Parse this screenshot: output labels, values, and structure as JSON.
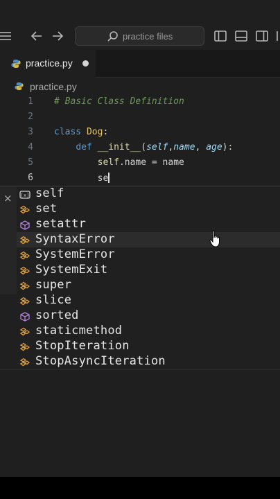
{
  "titlebar": {
    "search_label": "practice files"
  },
  "tabs": [
    {
      "label": "practice.py",
      "dirty": true
    }
  ],
  "breadcrumb": {
    "file": "practice.py"
  },
  "editor": {
    "lines": [
      {
        "number": "1",
        "text": "# Basic Class Definition"
      },
      {
        "number": "2",
        "text": ""
      },
      {
        "number": "3",
        "text": "class Dog:"
      },
      {
        "number": "4",
        "text": "    def __init__(self,name, age):"
      },
      {
        "number": "5",
        "text": "        self.name = name"
      },
      {
        "number": "6",
        "text": "        se"
      }
    ]
  },
  "suggest": {
    "close_label": "×",
    "items": [
      {
        "label": "self",
        "kind": "variable-icon"
      },
      {
        "label": "set",
        "kind": "class-icon"
      },
      {
        "label": "setattr",
        "kind": "method-icon"
      },
      {
        "label": "SyntaxError",
        "kind": "class-icon"
      },
      {
        "label": "SystemError",
        "kind": "class-icon"
      },
      {
        "label": "SystemExit",
        "kind": "class-icon"
      },
      {
        "label": "super",
        "kind": "class-icon"
      },
      {
        "label": "slice",
        "kind": "class-icon"
      },
      {
        "label": "sorted",
        "kind": "method-icon"
      },
      {
        "label": "staticmethod",
        "kind": "class-icon"
      },
      {
        "label": "StopIteration",
        "kind": "class-icon"
      },
      {
        "label": "StopAsyncIteration",
        "kind": "class-icon"
      }
    ]
  },
  "colors": {
    "background": "#1f1f1f",
    "keyword": "#569cd6",
    "comment": "#6a9955",
    "class_icon": "#e2a23b",
    "method_icon": "#b180d7"
  }
}
